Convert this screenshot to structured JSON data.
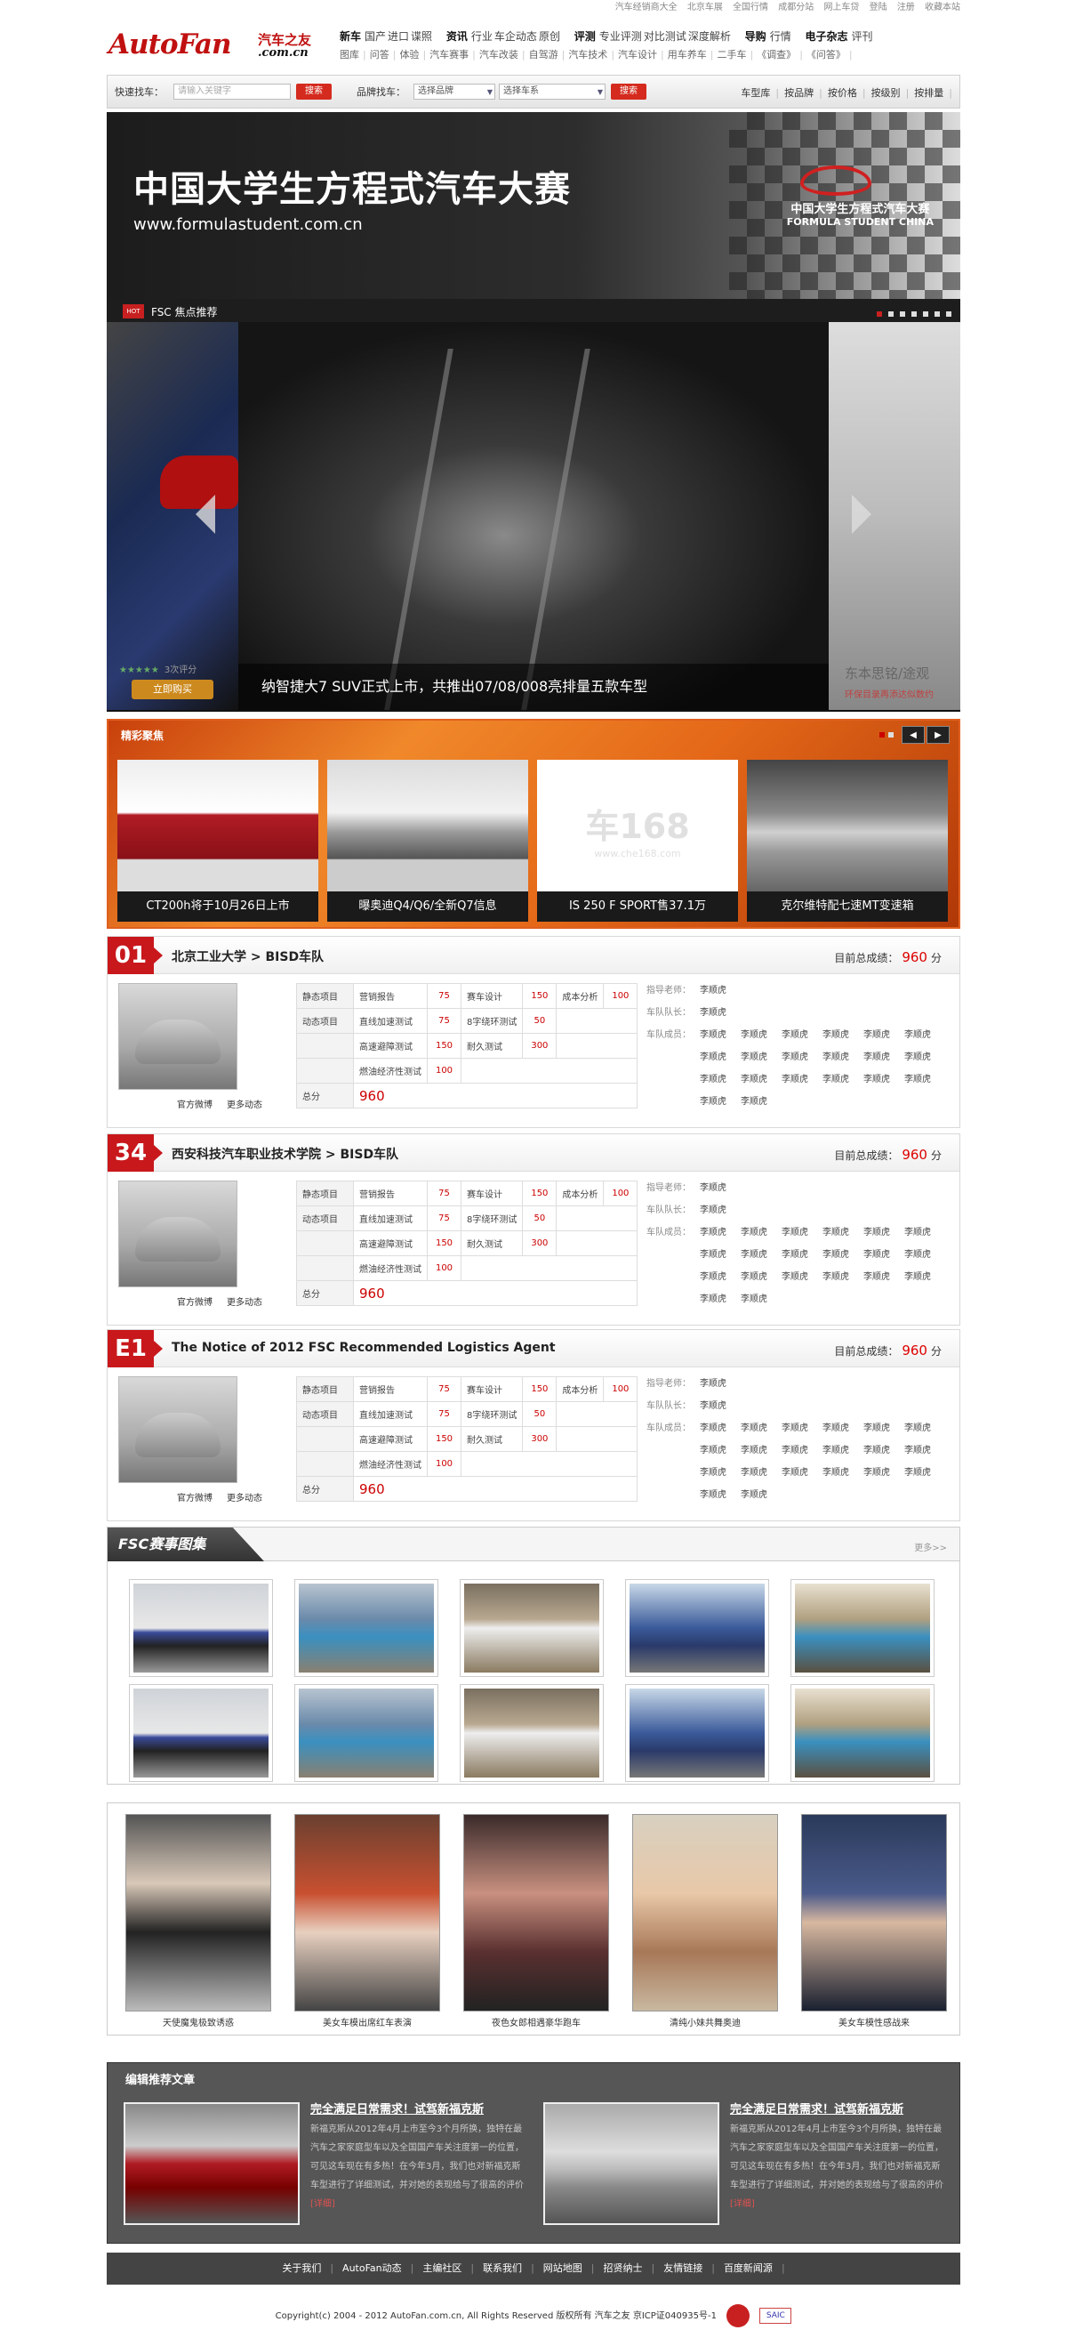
{
  "toplinks": [
    "汽车经销商大全",
    "北京车展",
    "全国行情",
    "成都分站",
    "网上车贷",
    "登陆",
    "注册",
    "收藏本站"
  ],
  "logo": {
    "en": "AutoFan",
    "cn": "汽车之友",
    "domain": ".com.cn"
  },
  "nav": {
    "row1": [
      {
        "title": "新车",
        "items": [
          "国产",
          "进口",
          "谍照"
        ]
      },
      {
        "title": "资讯",
        "items": [
          "行业",
          "车企动态",
          "原创"
        ]
      },
      {
        "title": "评测",
        "items": [
          "专业评测",
          "对比测试",
          "深度解析"
        ]
      },
      {
        "title": "导购",
        "items": [
          "行情"
        ]
      },
      {
        "title": "电子杂志",
        "items": [
          "评刊"
        ]
      }
    ],
    "row2": [
      "图库",
      "问答",
      "体验",
      "汽车赛事",
      "汽车改装",
      "自驾游",
      "汽车技术",
      "汽车设计",
      "用车养车",
      "二手车",
      "《调查》",
      "《问答》"
    ]
  },
  "search": {
    "quick_label": "快速找车：",
    "keyword_placeholder": "请输入关键字",
    "button": "搜索",
    "brand_label": "品牌找车：",
    "brand_select": "选择品牌",
    "series_select": "选择车系",
    "button2": "搜索",
    "quick_links": [
      "车型库",
      "按品牌",
      "按价格",
      "按级别",
      "按排量"
    ]
  },
  "banner": {
    "title": "中国大学生方程式汽车大赛",
    "url": "www.formulastudent.com.cn",
    "logo_cn": "中国大学生方程式汽车大赛",
    "logo_en": "FORMULA STUDENT CHINA"
  },
  "focus": {
    "hot": "HOT",
    "title": "FSC  焦点推荐",
    "caption": "纳智捷大7 SUV正式上市，共推出07/08/008亮排量五款车型",
    "stars": "★★★★★",
    "rating_count": "3次评分",
    "buy": "立即购买",
    "right_caption": "东本思铭/途观",
    "right_sub": "环保目录再添达似数约"
  },
  "jingcai": {
    "title": "精彩聚焦",
    "items": [
      {
        "caption": "CT200h将于10月26日上市",
        "color": "#b01c24"
      },
      {
        "caption": "曝奥迪Q4/Q6/全新Q7信息",
        "color": "#f2f2f2"
      },
      {
        "caption": "IS 250 F SPORT售37.1万",
        "color": "#ffffff"
      },
      {
        "caption": "克尔维特配七速MT变速箱",
        "color": "#b8b8b8"
      }
    ],
    "placeholder_logo": "车168",
    "placeholder_url": "www.che168.com"
  },
  "teams": [
    {
      "num": "01",
      "name": "北京工业大学  >  BISD车队",
      "score_label": "目前总成绩：",
      "score": "960",
      "unit": "分"
    },
    {
      "num": "34",
      "name": "西安科技汽车职业技术学院  >  BISD车队",
      "score_label": "目前总成绩：",
      "score": "960",
      "unit": "分"
    },
    {
      "num": "E1",
      "name": "The Notice of 2012 FSC Recommended Logistics Agent",
      "score_label": "目前总成绩：",
      "score": "960",
      "unit": "分"
    }
  ],
  "team_table": {
    "static": "静态项目",
    "dynamic": "动态项目",
    "total": "总分",
    "total_val": "960",
    "r1": [
      "营销报告",
      "75",
      "赛车设计",
      "150",
      "成本分析",
      "100"
    ],
    "r2": [
      "直线加速测试",
      "75",
      "8字绕环测试",
      "50"
    ],
    "r3": [
      "高速避障测试",
      "150",
      "耐久测试",
      "300"
    ],
    "r4": [
      "燃油经济性测试",
      "100"
    ]
  },
  "team_staff": {
    "teacher_k": "指导老师：",
    "teacher": "李顺虎",
    "captain_k": "车队队长：",
    "captain": "李顺虎",
    "member_k": "车队成员：",
    "member": "李顺虎"
  },
  "team_links": [
    "官方微博",
    "更多动态"
  ],
  "gallery": {
    "title": "FSC赛事图集",
    "more": "更多>>"
  },
  "girls": [
    "天使魔鬼极致诱惑",
    "美女车模出席红车表演",
    "夜色女郎相遇豪华跑车",
    "清纯小妹共舞奥迪",
    "美女车模性感战来"
  ],
  "editor": {
    "title": "编辑推荐文章",
    "articles": [
      {
        "head": "完全满足日常需求！试驾新福克斯",
        "body": "新福克斯从2012年4月上市至今3个月所换，独特在最汽车之家家庭型车以及全国国产车关注度第一的位置，可见这车现在有多热！在今年3月，我们也对新福克斯车型进行了详细测试，并对她的表现给与了很高的评价",
        "more": "[详细]"
      },
      {
        "head": "完全满足日常需求！试驾新福克斯",
        "body": "新福克斯从2012年4月上市至今3个月所换，独特在最汽车之家家庭型车以及全国国产车关注度第一的位置，可见这车现在有多热！在今年3月，我们也对新福克斯车型进行了详细测试，并对她的表现给与了很高的评价",
        "more": "[详细]"
      }
    ]
  },
  "footer": {
    "links": [
      "关于我们",
      "AutoFan动态",
      "主编社区",
      "联系我们",
      "网站地图",
      "招贤纳士",
      "友情链接",
      "百度新闻源"
    ],
    "copyright": "Copyright(c) 2004 - 2012 AutoFan.com.cn, All Rights Reserved 版权所有 汽车之友 京ICP证040935号-1",
    "badge": "SAIC"
  }
}
